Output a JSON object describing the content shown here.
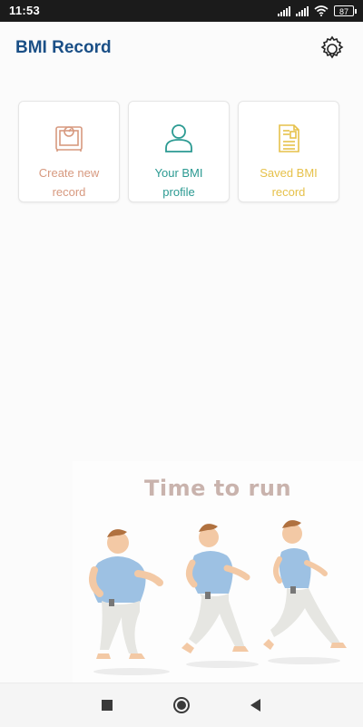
{
  "status_bar": {
    "time": "11:53",
    "battery": "87",
    "icons": [
      "signal-icon",
      "signal-icon",
      "wifi-icon",
      "battery-icon"
    ]
  },
  "app_bar": {
    "title": "BMI Record",
    "settings_icon": "gear-icon"
  },
  "tiles": [
    {
      "line1": "Create new",
      "line2": "record",
      "icon": "scale-icon",
      "color": "#d7997f"
    },
    {
      "line1": "Your BMI",
      "line2": "profile",
      "icon": "user-icon",
      "color": "#2b9a92"
    },
    {
      "line1": "Saved BMI",
      "line2": "record",
      "icon": "document-icon",
      "color": "#e6c14a"
    }
  ],
  "illustration": {
    "title": "Time to run"
  },
  "nav_bar": {
    "icons": [
      "recents-icon",
      "home-icon",
      "back-icon"
    ]
  }
}
